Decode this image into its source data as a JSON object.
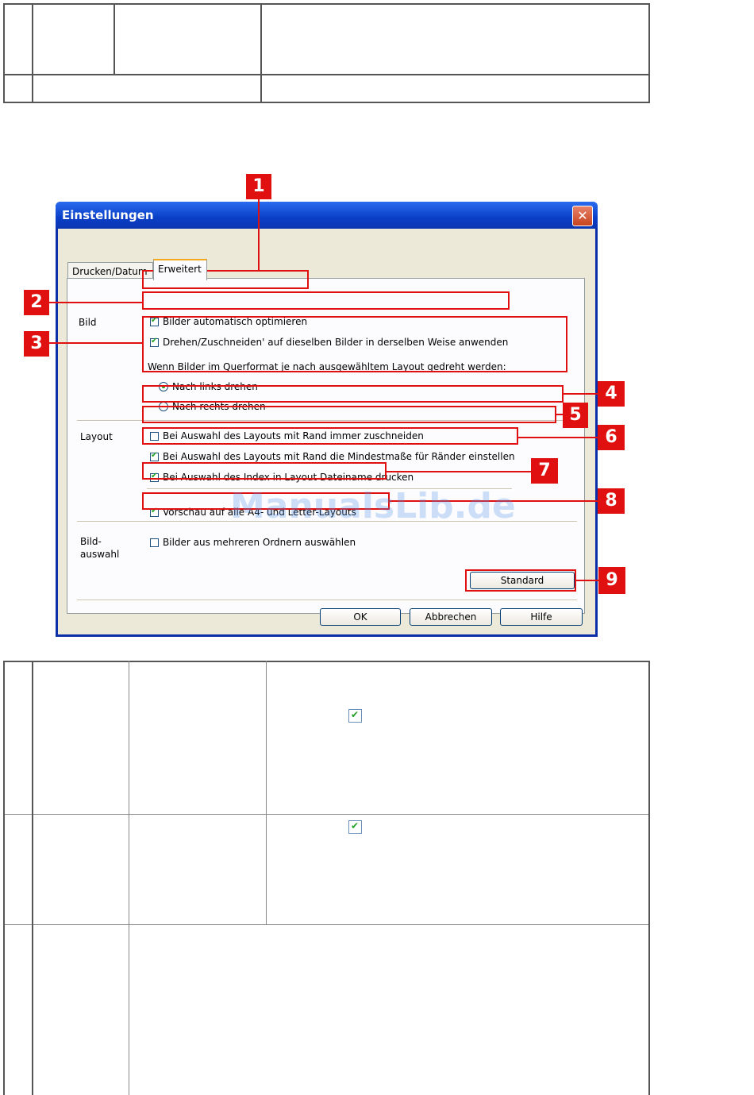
{
  "dialog": {
    "title": "Einstellungen",
    "close_glyph": "✕",
    "tabs": [
      "Drucken/Datum",
      "Erweitert"
    ],
    "active_tab": "Erweitert",
    "sections": {
      "bild": "Bild",
      "layout": "Layout",
      "bildauswahl_1": "Bild-",
      "bildauswahl_2": "auswahl"
    },
    "options": {
      "auto_optimize": {
        "label": "Bilder automatisch optimieren",
        "checked": true
      },
      "apply_same": {
        "label": "Drehen/Zuschneiden' auf dieselben Bilder in derselben Weise anwenden",
        "checked": true
      },
      "rotate_question": "Wenn Bilder im Querformat je nach ausgewähltem Layout gedreht werden:",
      "rotate_left": {
        "label": "Nach links drehen",
        "selected": true
      },
      "rotate_right": {
        "label": "Nach rechts drehen",
        "selected": false
      },
      "always_crop": {
        "label": "Bei Auswahl des Layouts mit Rand immer zuschneiden",
        "checked": false
      },
      "min_margins": {
        "label": "Bei Auswahl des Layouts mit Rand die Mindestmaße für Ränder einstellen",
        "checked": true
      },
      "print_filename": {
        "label": "Bei Auswahl des Index in Layout Dateiname drucken",
        "checked": true
      },
      "preview_a4": {
        "label": "Vorschau auf alle A4- und Letter-Layouts",
        "checked": true
      },
      "multi_select": {
        "label": "Bilder aus mehreren Ordnern auswählen",
        "checked": false
      }
    },
    "buttons": {
      "standard": "Standard",
      "ok": "OK",
      "cancel": "Abbrechen",
      "help": "Hilfe"
    }
  },
  "callouts": [
    "1",
    "2",
    "3",
    "4",
    "5",
    "6",
    "7",
    "8",
    "9"
  ],
  "watermark": "ManualsLib.de",
  "colors": {
    "callout": "#e01010",
    "title_bar": "#0a3fc6",
    "dialog_face": "#ece9d8",
    "check_mark": "#21a121"
  }
}
